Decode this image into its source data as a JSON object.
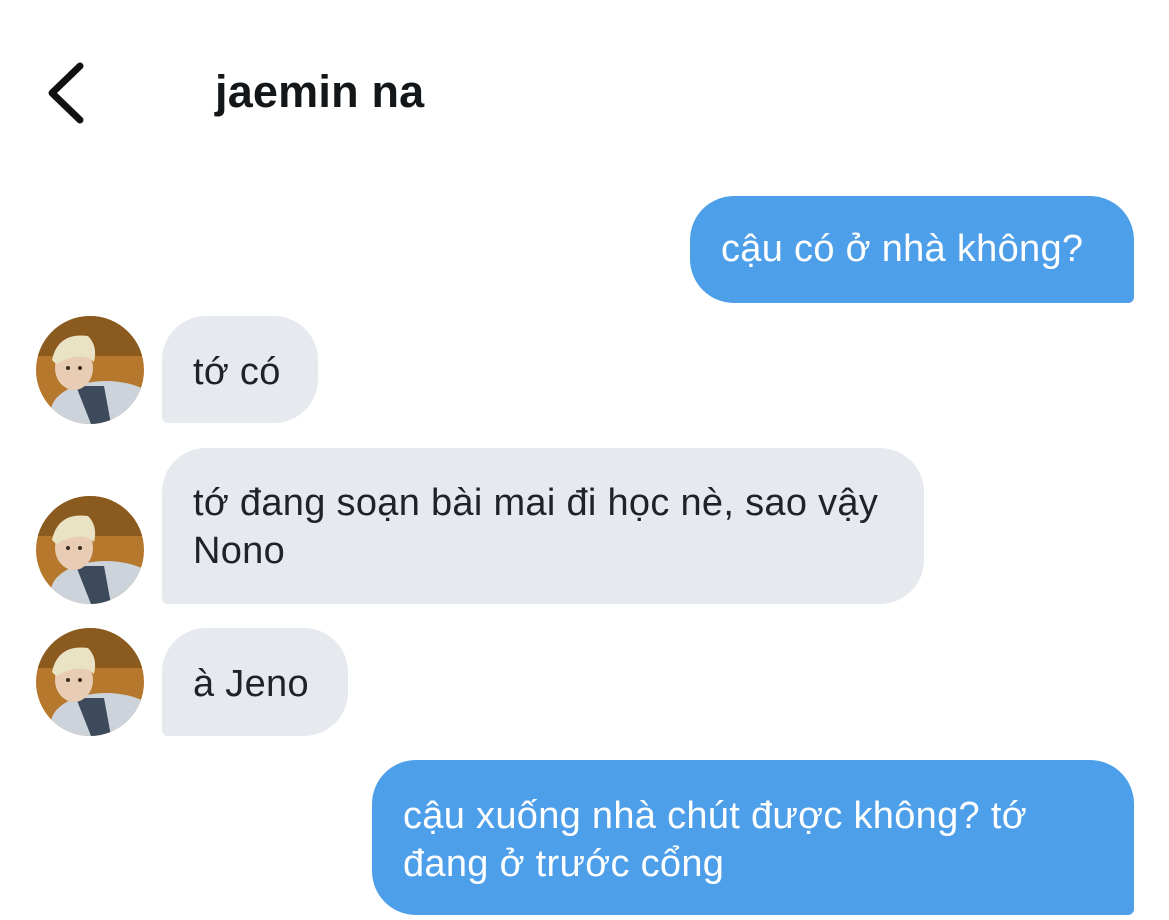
{
  "header": {
    "back_icon": "chevron-left-icon",
    "title": "jaemin na"
  },
  "contact": {
    "avatar_icon": "avatar-photo"
  },
  "messages": [
    {
      "direction": "outgoing",
      "text": "cậu có ở nhà không?"
    },
    {
      "direction": "incoming",
      "text": "tớ có"
    },
    {
      "direction": "incoming",
      "text": "tớ đang soạn bài mai đi học nè, sao vậy Nono"
    },
    {
      "direction": "incoming",
      "text": "à Jeno"
    },
    {
      "direction": "outgoing",
      "text": "cậu xuống nhà chút được không? tớ đang ở trước cổng"
    }
  ],
  "colors": {
    "outgoing_bubble": "#4d9fea",
    "incoming_bubble": "#e6eaee",
    "outgoing_text": "#ffffff",
    "incoming_text": "#1f2328"
  }
}
